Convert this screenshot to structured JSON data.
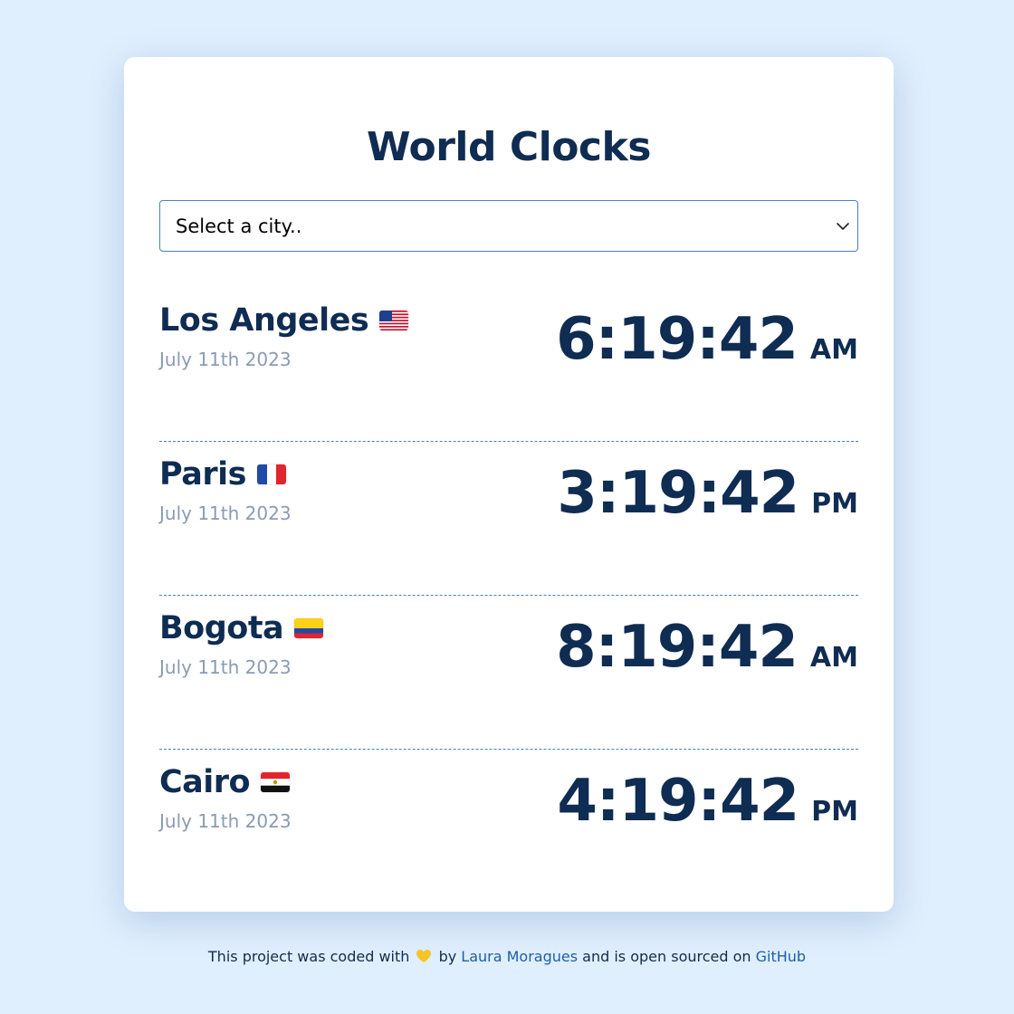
{
  "header": {
    "title": "World Clocks"
  },
  "city_select": {
    "selected": "Select a city..",
    "icon": "chevron-down-icon"
  },
  "cities": [
    {
      "name": "Los Angeles",
      "flag": "us-flag-icon",
      "date": "July 11th 2023",
      "time": "6:19:42",
      "ampm": "AM"
    },
    {
      "name": "Paris",
      "flag": "france-flag-icon",
      "date": "July 11th 2023",
      "time": "3:19:42",
      "ampm": "PM"
    },
    {
      "name": "Bogota",
      "flag": "colombia-flag-icon",
      "date": "July 11th 2023",
      "time": "8:19:42",
      "ampm": "AM"
    },
    {
      "name": "Cairo",
      "flag": "egypt-flag-icon",
      "date": "July 11th 2023",
      "time": "4:19:42",
      "ampm": "PM"
    }
  ],
  "footer": {
    "text_before": "This project was coded with",
    "heart_icon": "yellow-heart-icon",
    "text_by": "by",
    "author_link": "Laura Moragues",
    "text_middle": "and is open sourced on",
    "github_link": "GitHub"
  },
  "colors": {
    "background": "#e0effd",
    "primary_text": "#0f2c52",
    "muted_text": "#8a9bb4",
    "link": "#1b5fae",
    "accent_border": "#4b7fc0"
  }
}
